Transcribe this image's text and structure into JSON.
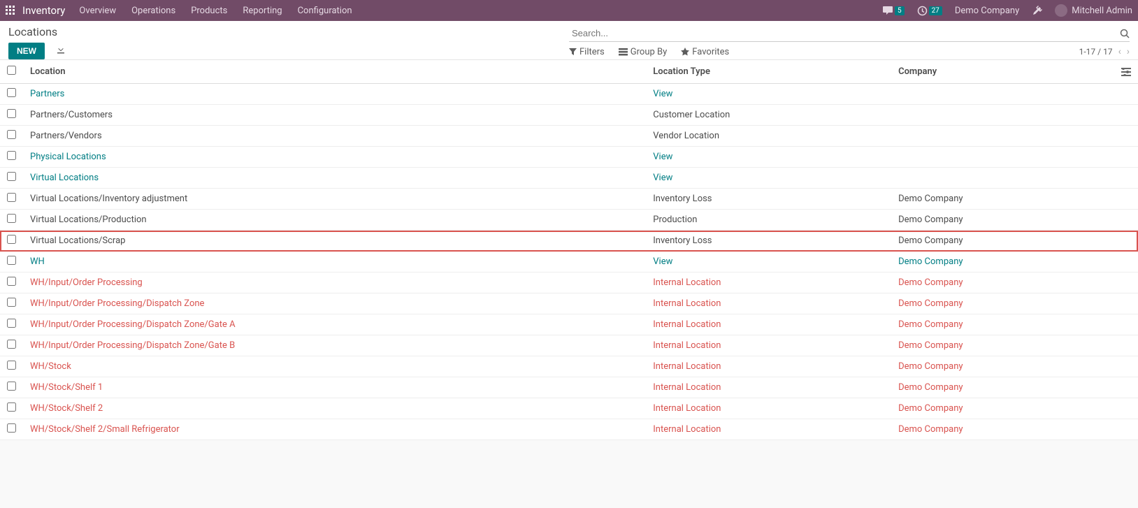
{
  "topbar": {
    "app_title": "Inventory",
    "menus": [
      "Overview",
      "Operations",
      "Products",
      "Reporting",
      "Configuration"
    ],
    "msg_badge": "5",
    "activity_badge": "27",
    "company": "Demo Company",
    "user": "Mitchell Admin"
  },
  "controls": {
    "breadcrumb": "Locations",
    "new_btn": "NEW",
    "search_placeholder": "Search...",
    "filters": "Filters",
    "groupby": "Group By",
    "favorites": "Favorites",
    "pager": "1-17 / 17"
  },
  "table": {
    "headers": {
      "location": "Location",
      "type": "Location Type",
      "company": "Company"
    },
    "rows": [
      {
        "location": "Partners",
        "type": "View",
        "company": "",
        "style": "teal",
        "highlight": false
      },
      {
        "location": "Partners/Customers",
        "type": "Customer Location",
        "company": "",
        "style": "normal",
        "highlight": false
      },
      {
        "location": "Partners/Vendors",
        "type": "Vendor Location",
        "company": "",
        "style": "normal",
        "highlight": false
      },
      {
        "location": "Physical Locations",
        "type": "View",
        "company": "",
        "style": "teal",
        "highlight": false
      },
      {
        "location": "Virtual Locations",
        "type": "View",
        "company": "",
        "style": "teal",
        "highlight": false
      },
      {
        "location": "Virtual Locations/Inventory adjustment",
        "type": "Inventory Loss",
        "company": "Demo Company",
        "style": "normal",
        "highlight": false
      },
      {
        "location": "Virtual Locations/Production",
        "type": "Production",
        "company": "Demo Company",
        "style": "normal",
        "highlight": false
      },
      {
        "location": "Virtual Locations/Scrap",
        "type": "Inventory Loss",
        "company": "Demo Company",
        "style": "normal",
        "highlight": true
      },
      {
        "location": "WH",
        "type": "View",
        "company": "Demo Company",
        "style": "teal",
        "highlight": false
      },
      {
        "location": "WH/Input/Order Processing",
        "type": "Internal Location",
        "company": "Demo Company",
        "style": "red",
        "highlight": false
      },
      {
        "location": "WH/Input/Order Processing/Dispatch Zone",
        "type": "Internal Location",
        "company": "Demo Company",
        "style": "red",
        "highlight": false
      },
      {
        "location": "WH/Input/Order Processing/Dispatch Zone/Gate A",
        "type": "Internal Location",
        "company": "Demo Company",
        "style": "red",
        "highlight": false
      },
      {
        "location": "WH/Input/Order Processing/Dispatch Zone/Gate B",
        "type": "Internal Location",
        "company": "Demo Company",
        "style": "red",
        "highlight": false
      },
      {
        "location": "WH/Stock",
        "type": "Internal Location",
        "company": "Demo Company",
        "style": "red",
        "highlight": false
      },
      {
        "location": "WH/Stock/Shelf 1",
        "type": "Internal Location",
        "company": "Demo Company",
        "style": "red",
        "highlight": false
      },
      {
        "location": "WH/Stock/Shelf 2",
        "type": "Internal Location",
        "company": "Demo Company",
        "style": "red",
        "highlight": false
      },
      {
        "location": "WH/Stock/Shelf 2/Small Refrigerator",
        "type": "Internal Location",
        "company": "Demo Company",
        "style": "red",
        "highlight": false
      }
    ]
  }
}
